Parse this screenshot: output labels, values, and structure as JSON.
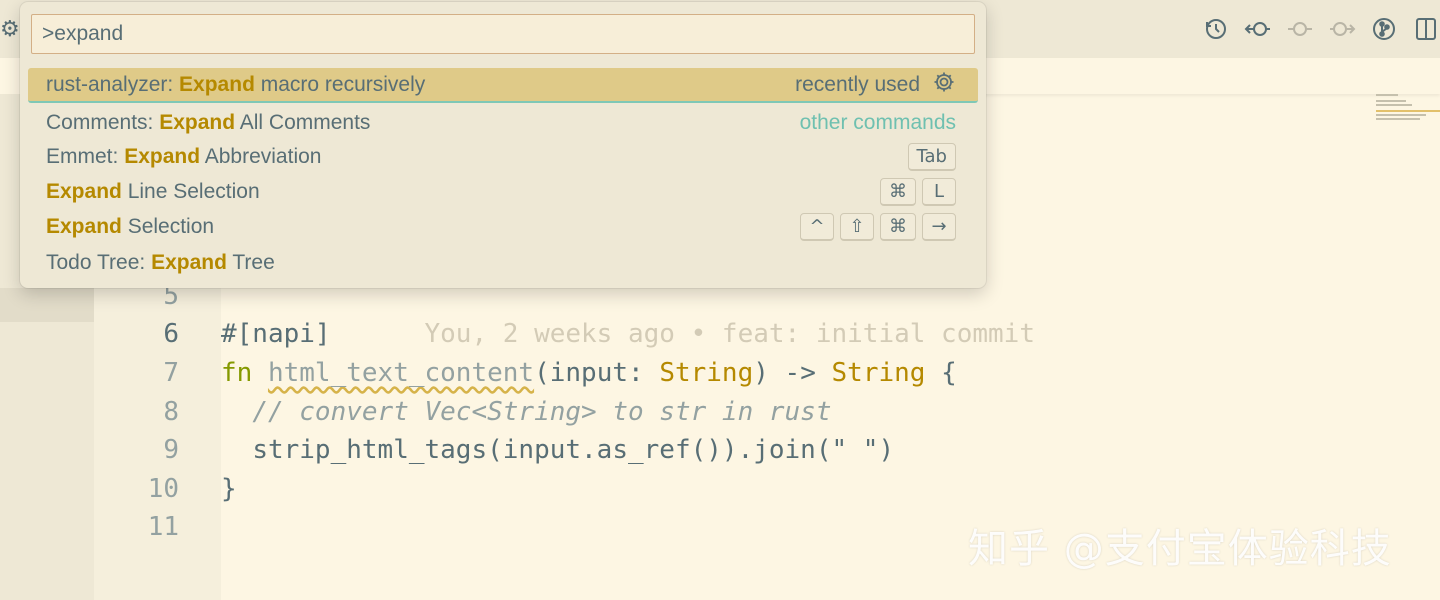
{
  "palette": {
    "query": ">expand",
    "items": [
      {
        "prefix": "rust-analyzer: ",
        "match": "Expand",
        "suffix": " macro recursively",
        "tag": "recently used"
      },
      {
        "prefix": "Comments: ",
        "match": "Expand",
        "suffix": " All Comments",
        "tag": "other commands"
      },
      {
        "prefix": "Emmet: ",
        "match": "Expand",
        "suffix": " Abbreviation",
        "keys": [
          "Tab"
        ]
      },
      {
        "prefix": "",
        "match": "Expand",
        "suffix": " Line Selection",
        "keys": [
          "⌘",
          "L"
        ]
      },
      {
        "prefix": "",
        "match": "Expand",
        "suffix": " Selection",
        "keys": [
          "^",
          "⇧",
          "⌘",
          "→"
        ]
      },
      {
        "prefix": "Todo Tree: ",
        "match": "Expand",
        "suffix": " Tree"
      }
    ]
  },
  "editor": {
    "line_numbers": [
      "5",
      "6",
      "7",
      "8",
      "9",
      "10",
      "11"
    ],
    "lines": {
      "l6_attr": "#[napi]",
      "l6_blame": "You, 2 weeks ago • feat: initial commit",
      "l7_kw": "fn",
      "l7_name": "html_text_content",
      "l7_open": "(input: ",
      "l7_type1": "String",
      "l7_arrow": ") -> ",
      "l7_type2": "String",
      "l7_brace": " {",
      "l8_comment": "// convert Vec<String> to str in rust",
      "l9_call": "strip_html_tags(input.as_ref()).join(",
      "l9_str": "\" \"",
      "l9_close": ")",
      "l10": "}"
    }
  },
  "watermark": "知乎 @支付宝体验科技",
  "icons": {
    "settings": "gear-icon",
    "timeline": "history-icon",
    "go_back": "go-back-icon",
    "commit": "commit-icon",
    "go_forward": "go-forward-icon",
    "source_control": "git-graph-icon",
    "split_editor": "split-editor-icon"
  },
  "colors": {
    "background": "#fdf6e3",
    "highlight": "#b58900",
    "selected_row": "#dfca88",
    "accent_teal": "#6fc0b0"
  }
}
